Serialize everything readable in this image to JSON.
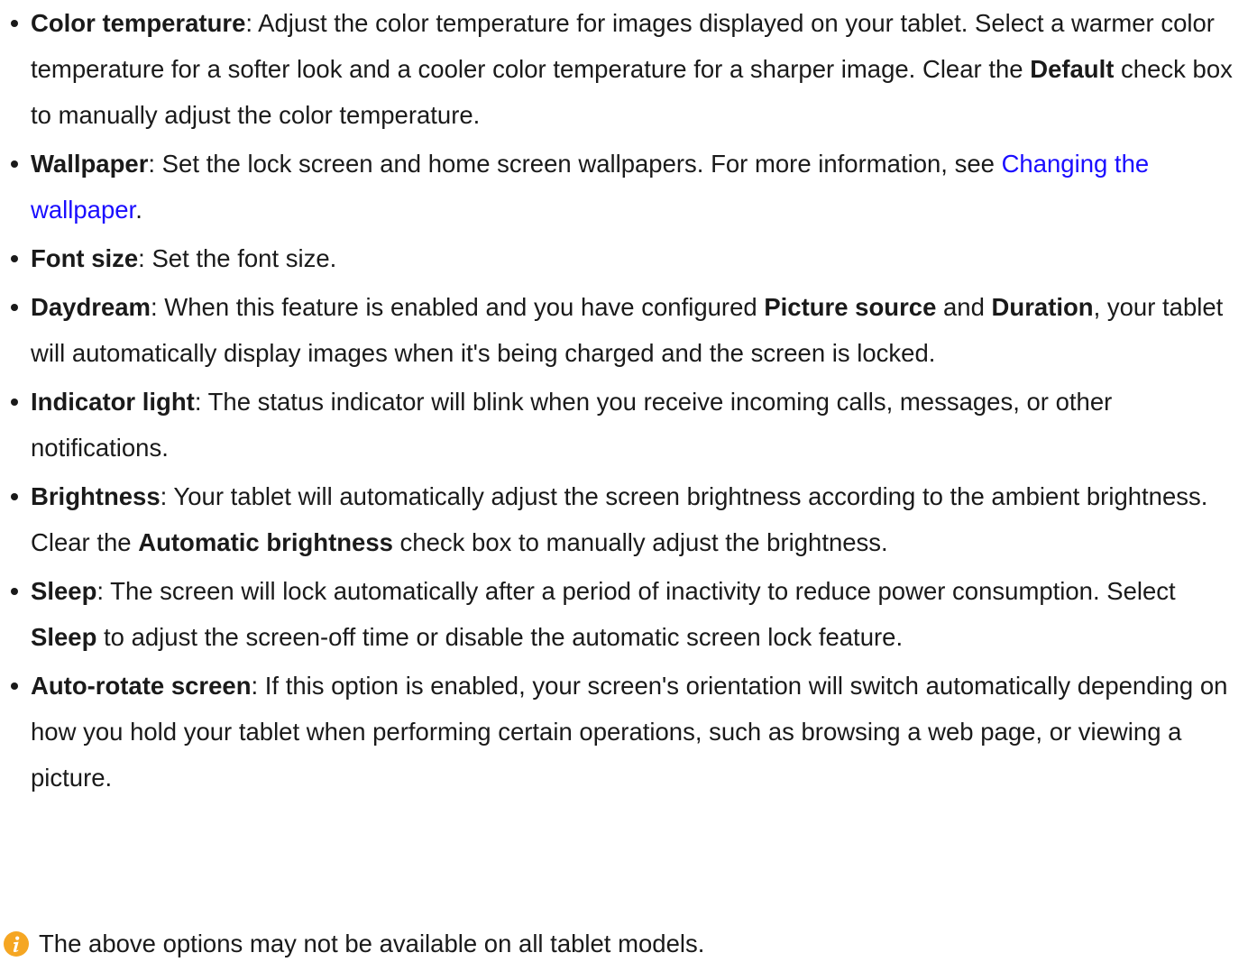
{
  "items": [
    {
      "title": "Color temperature",
      "text1": ": Adjust the color temperature for images displayed on your tablet. Select a warmer color temperature for a softer look and a cooler color temperature for a sharper image. Clear the ",
      "bold1": "Default",
      "text2": " check box to manually adjust the color temperature."
    },
    {
      "title": "Wallpaper",
      "text1": ": Set the lock screen and home screen wallpapers. For more information, see ",
      "link": "Changing the wallpaper",
      "text2": "."
    },
    {
      "title": "Font size",
      "text1": ": Set the font size."
    },
    {
      "title": "Daydream",
      "text1": ": When this feature is enabled and you have configured ",
      "bold1": "Picture source",
      "text2": " and ",
      "bold2": "Duration",
      "text3": ", your tablet will automatically display images when it's being charged and the screen is locked."
    },
    {
      "title": "Indicator light",
      "text1": ": The status indicator will blink when you receive incoming calls, messages, or other notifications."
    },
    {
      "title": "Brightness",
      "text1": ": Your tablet will automatically adjust the screen brightness according to the ambient brightness. Clear the ",
      "bold1": "Automatic brightness",
      "text2": " check box to manually adjust the brightness."
    },
    {
      "title": "Sleep",
      "text1": ": The screen will lock automatically after a period of inactivity to reduce power consumption. Select ",
      "bold1": "Sleep",
      "text2": " to adjust the screen-off time or disable the automatic screen lock feature."
    },
    {
      "title": "Auto-rotate screen",
      "text1": ": If this option is enabled, your screen's orientation will switch automatically depending on how you hold your tablet when performing certain operations, such as browsing a web page, or viewing a picture."
    }
  ],
  "note": {
    "icon": "info-icon",
    "text": "The above options may not be available on all tablet models."
  },
  "colors": {
    "text": "#1a1a1a",
    "link": "#1a0dff",
    "info_icon": "#f5a623"
  }
}
